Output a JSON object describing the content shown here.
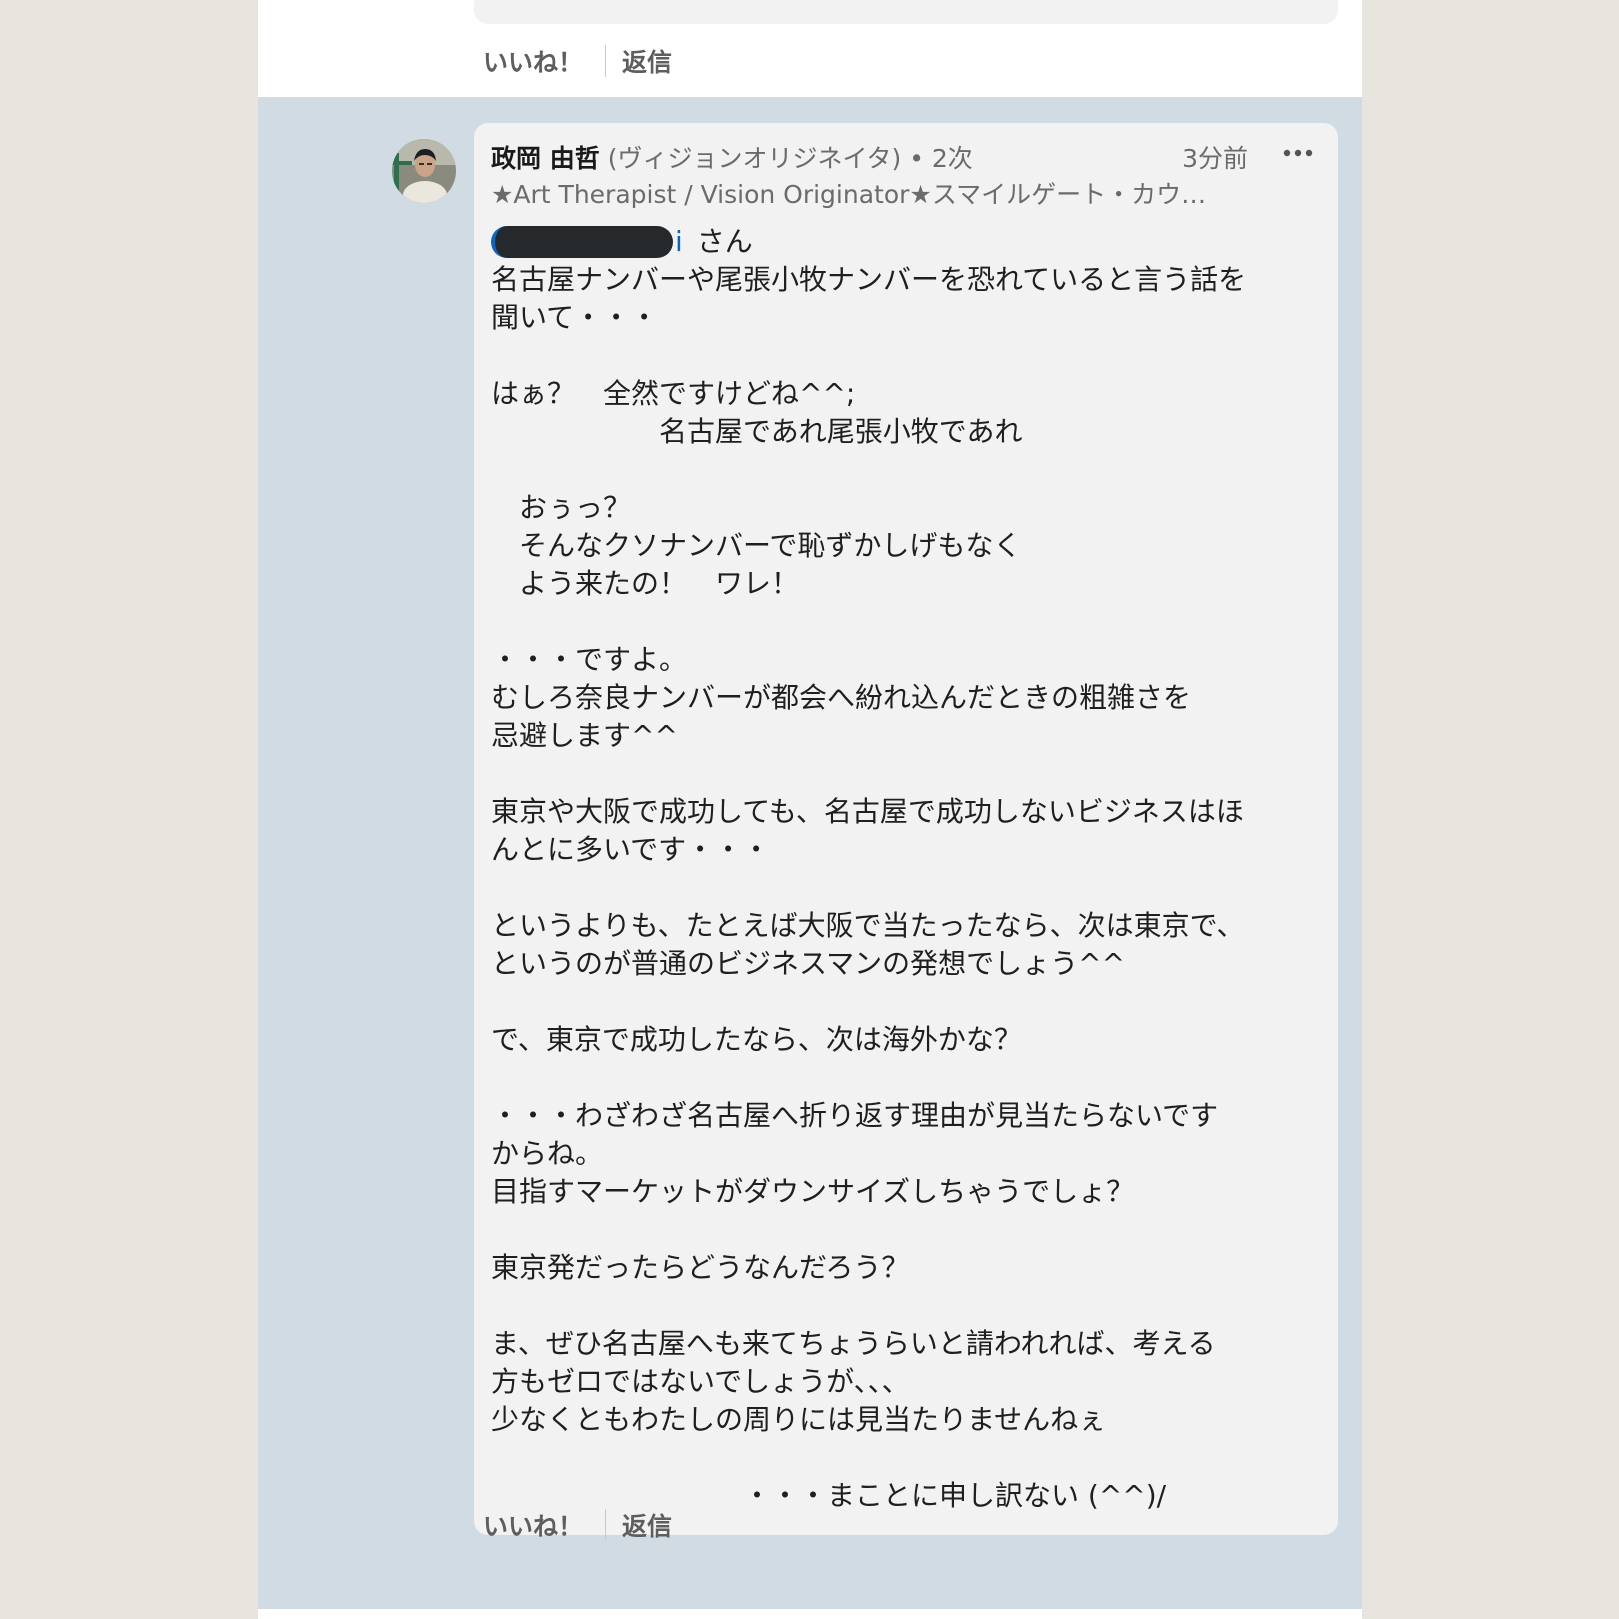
{
  "previous_comment": {
    "actions": {
      "like": "いいね！",
      "reply": "返信"
    }
  },
  "comment": {
    "author_name": "政岡 由哲",
    "pronunciation": "(ヴィジョンオリジネイタ)",
    "degree": "• 2次",
    "time": "3分前",
    "headline": "★Art Therapist / Vision Originator★スマイルゲート・カウ…",
    "mention_tail": "i",
    "mention_suffix": "さん",
    "lines": [
      "名古屋ナンバーや尾張小牧ナンバーを恐れていると言う話を",
      "聞いて・・・",
      "",
      "はぁ？　全然ですけどね^^;",
      "　　　　　　名古屋であれ尾張小牧であれ",
      "",
      "　おぅっ？",
      "　そんなクソナンバーで恥ずかしげもなく",
      "　よう来たの！　ワレ！",
      "",
      "・・・ですよ。",
      "むしろ奈良ナンバーが都会へ紛れ込んだときの粗雑さを",
      "忌避します^^",
      "",
      "東京や大阪で成功しても、名古屋で成功しないビジネスはほ",
      "んとに多いです・・・",
      "",
      "というよりも、たとえば大阪で当たったなら、次は東京で、",
      "というのが普通のビジネスマンの発想でしょう^^",
      "",
      "で、東京で成功したなら、次は海外かな？",
      "",
      "・・・わざわざ名古屋へ折り返す理由が見当たらないです",
      "からね。",
      "目指すマーケットがダウンサイズしちゃうでしょ？",
      "",
      "東京発だったらどうなんだろう？",
      "",
      "ま、ぜひ名古屋へも来てちょうらいと請われれば、考える",
      "方もゼロではないでしょうが、、、",
      "少なくともわたしの周りには見当たりませんねぇ",
      "",
      "　　　　　　　　　・・・まことに申し訳ない (^^)/"
    ],
    "actions": {
      "like": "いいね！",
      "reply": "返信"
    }
  },
  "colors": {
    "highlight_background": "#d0dbe4",
    "bubble_background": "#f2f2f2",
    "mention_link": "#0a66c2",
    "page_background": "#e8e5de"
  }
}
